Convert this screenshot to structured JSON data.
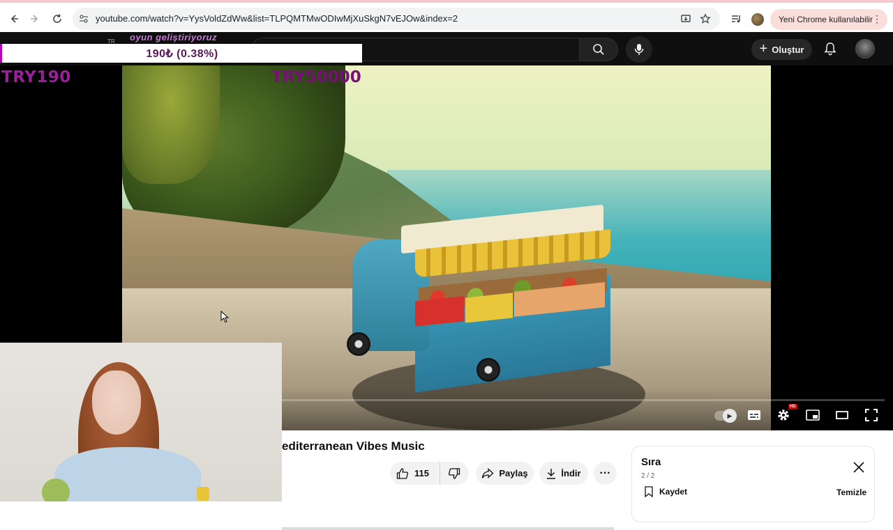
{
  "browser": {
    "url": "youtube.com/watch?v=YysVoldZdWw&list=TLPQMTMwODIwMjXuSkgN7vEJOw&index=2",
    "update_button_label": "Yeni Chrome kullanılabilir",
    "icons": [
      "back-icon",
      "forward-icon",
      "reload-icon",
      "site-info-icon",
      "install-icon",
      "bookmark-star-icon",
      "media-control-icon",
      "profile-icon",
      "menu-dots-icon"
    ]
  },
  "youtube_header": {
    "create_label": "Oluştur",
    "icons": [
      "search-icon",
      "microphone-icon",
      "bell-icon",
      "avatar"
    ]
  },
  "stream_overlay": {
    "top_text": "oyun geliştiriyoruz",
    "small_label": "TR",
    "donation_bar_text": "190₺ (0.38%)",
    "donation_progress_percent": 0.38,
    "goal_left": "TRY190",
    "goal_right": "TRY50000"
  },
  "video": {
    "title": "editerranean Vibes Music",
    "like_count": "115",
    "share_label": "Paylaş",
    "download_label": "İndir",
    "more_label": "···"
  },
  "queue": {
    "title": "Sıra",
    "count": "2 / 2",
    "save_label": "Kaydet",
    "clear_label": "Temizle"
  },
  "colors": {
    "chrome_update_pill": "#f9dedc",
    "yt_dark": "#0f0f0f",
    "overlay_purple": "#9b1f9b"
  }
}
